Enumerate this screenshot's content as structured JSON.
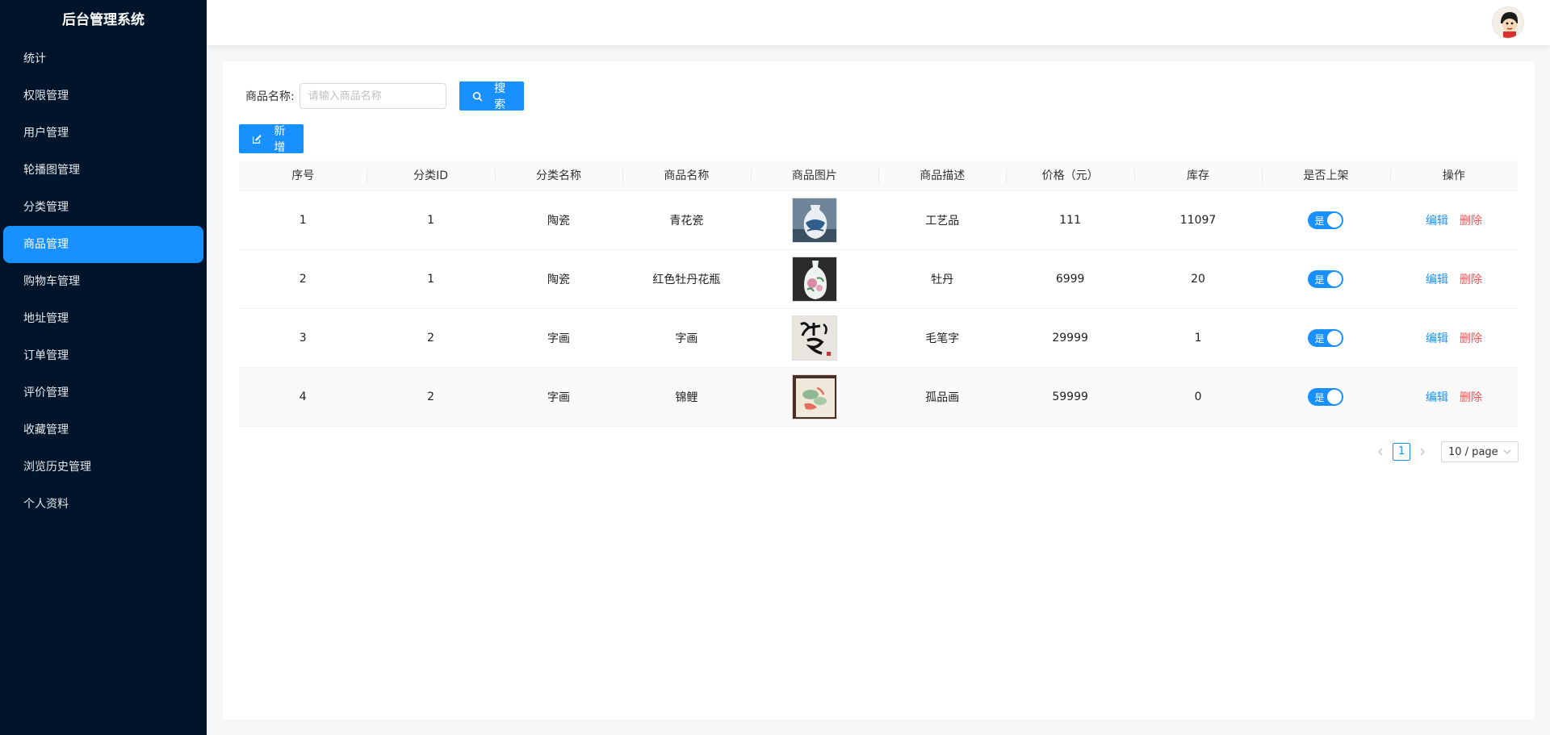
{
  "app": {
    "title": "后台管理系统"
  },
  "sidebar": {
    "items": [
      {
        "label": "统计",
        "active": false
      },
      {
        "label": "权限管理",
        "active": false
      },
      {
        "label": "用户管理",
        "active": false
      },
      {
        "label": "轮播图管理",
        "active": false
      },
      {
        "label": "分类管理",
        "active": false
      },
      {
        "label": "商品管理",
        "active": true
      },
      {
        "label": "购物车管理",
        "active": false
      },
      {
        "label": "地址管理",
        "active": false
      },
      {
        "label": "订单管理",
        "active": false
      },
      {
        "label": "评价管理",
        "active": false
      },
      {
        "label": "收藏管理",
        "active": false
      },
      {
        "label": "浏览历史管理",
        "active": false
      },
      {
        "label": "个人资料",
        "active": false
      }
    ]
  },
  "search": {
    "label": "商品名称:",
    "placeholder": "请输入商品名称",
    "value": "",
    "button_label": "搜索"
  },
  "toolbar": {
    "add_label": "新增"
  },
  "table": {
    "columns": [
      "序号",
      "分类ID",
      "分类名称",
      "商品名称",
      "商品图片",
      "商品描述",
      "价格（元）",
      "库存",
      "是否上架",
      "操作"
    ],
    "rows": [
      {
        "index": "1",
        "category_id": "1",
        "category_name": "陶瓷",
        "name": "青花瓷",
        "image": "blue-white-vase",
        "description": "工艺品",
        "price": "111",
        "stock": "11097",
        "on_sale": "是"
      },
      {
        "index": "2",
        "category_id": "1",
        "category_name": "陶瓷",
        "name": "红色牡丹花瓶",
        "image": "peony-vase",
        "description": "牡丹",
        "price": "6999",
        "stock": "20",
        "on_sale": "是"
      },
      {
        "index": "3",
        "category_id": "2",
        "category_name": "字画",
        "name": "字画",
        "image": "calligraphy",
        "description": "毛笔字",
        "price": "29999",
        "stock": "1",
        "on_sale": "是"
      },
      {
        "index": "4",
        "category_id": "2",
        "category_name": "字画",
        "name": "锦鲤",
        "image": "koi-painting",
        "description": "孤品画",
        "price": "59999",
        "stock": "0",
        "on_sale": "是"
      }
    ],
    "actions": {
      "edit_label": "编辑",
      "delete_label": "删除"
    }
  },
  "pagination": {
    "current_page": "1",
    "page_size_label": "10 / page"
  },
  "colors": {
    "primary": "#1890ff",
    "danger": "#ff4d4f",
    "sidebar_bg": "#001529"
  }
}
